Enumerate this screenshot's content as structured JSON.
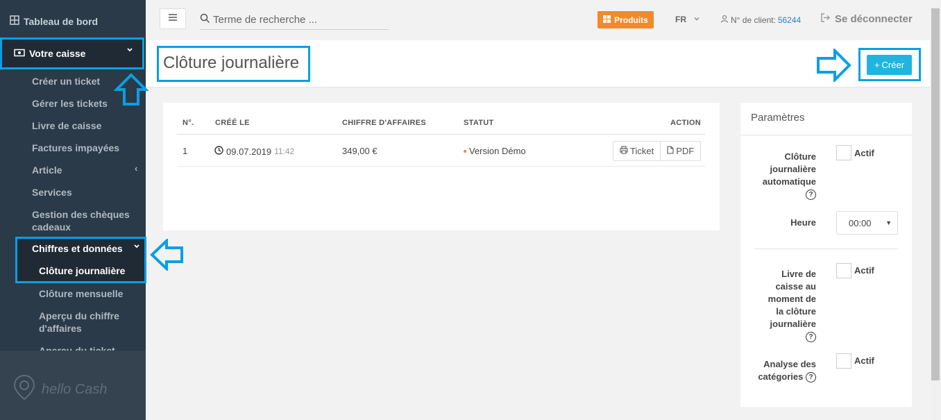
{
  "sidebar": {
    "dashboard": "Tableau de bord",
    "caisse": "Votre caisse",
    "items": [
      "Créer un ticket",
      "Gérer les tickets",
      "Livre de caisse",
      "Factures impayées",
      "Article",
      "Services",
      "Gestion des chèques cadeaux"
    ],
    "chiffres": "Chiffres et données",
    "subitems": [
      "Clôture journalière",
      "Clôture mensuelle",
      "Aperçu du chiffre d'affaires",
      "Aperçu du ticket"
    ],
    "brand": "hello Cash"
  },
  "topbar": {
    "search_placeholder": "Terme de recherche ...",
    "produits": "Produits",
    "lang": "FR",
    "client_label": "N° de client:",
    "client_number": "56244",
    "logout": "Se déconnecter"
  },
  "page": {
    "title": "Clôture journalière",
    "create": "Créer"
  },
  "table": {
    "headers": [
      "N°.",
      "CRÉÉ LE",
      "CHIFFRE D'AFFAIRES",
      "STATUT",
      "ACTION"
    ],
    "rows": [
      {
        "num": "1",
        "date": "09.07.2019",
        "time": "11:42",
        "amount": "349,00 €",
        "status": "Version Démo",
        "ticket": "Ticket",
        "pdf": "PDF"
      }
    ]
  },
  "params": {
    "title": "Paramètres",
    "auto_label_lines": [
      "Clôture",
      "journalière",
      "automatique"
    ],
    "active": "Actif",
    "heure_label": "Heure",
    "heure_value": "00:00",
    "livre_label_lines": [
      "Livre de",
      "caisse au",
      "moment de",
      "la clôture",
      "journalière"
    ],
    "analyse_label_lines": [
      "Analyse des",
      "catégories"
    ]
  },
  "colors": {
    "sidebar": "#2b3a48",
    "accent": "#1fb5e0",
    "orange": "#f18a2a",
    "highlight": "#0a9fe3"
  }
}
